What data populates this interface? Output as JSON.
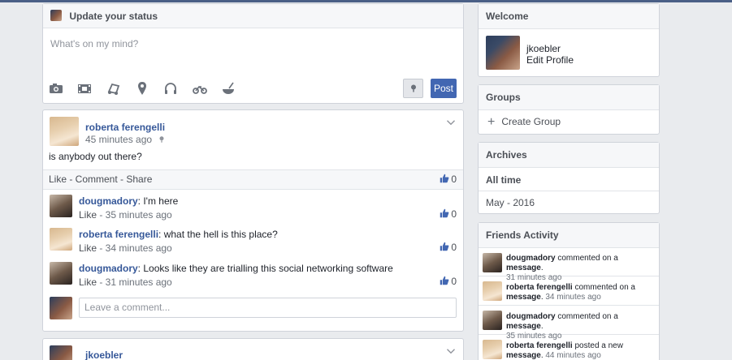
{
  "status_box": {
    "title": "Update your status",
    "placeholder": "What's on my mind?",
    "post_label": "Post",
    "tool_icons": [
      "camera-icon",
      "video-icon",
      "music-icon",
      "location-icon",
      "headphones-icon",
      "bike-icon",
      "food-icon"
    ]
  },
  "post": {
    "author": "roberta ferengelli",
    "time": "45 minutes ago",
    "text": "is anybody out there?",
    "actions": "Like - Comment - Share",
    "likes": "0",
    "comments": [
      {
        "author": "dougmadory",
        "text": ": I'm here",
        "meta_like": "Like",
        "meta_time": " - 35 minutes ago",
        "likes": "0"
      },
      {
        "author": "roberta ferengelli",
        "text": ": what the hell is this place?",
        "meta_like": "Like",
        "meta_time": " - 34 minutes ago",
        "likes": "0"
      },
      {
        "author": "dougmadory",
        "text": ": Looks like they are trialling this social networking software",
        "meta_like": "Like",
        "meta_time": " - 31 minutes ago",
        "likes": "0"
      }
    ],
    "comment_placeholder": "Leave a comment..."
  },
  "next_post": {
    "author": "jkoebler"
  },
  "welcome": {
    "title": "Welcome",
    "username": "jkoebler",
    "edit_profile": "Edit Profile"
  },
  "groups": {
    "title": "Groups",
    "create": "Create Group"
  },
  "archives": {
    "title": "Archives",
    "items": [
      "All time",
      "May - 2016"
    ]
  },
  "friends": {
    "title": "Friends Activity",
    "items": [
      {
        "name": "dougmadory",
        "action": " commented on a ",
        "object": "message",
        "time": "31 minutes ago"
      },
      {
        "name": "roberta ferengelli",
        "action": " commented on a ",
        "object": "message",
        "time": " 34 minutes ago"
      },
      {
        "name": "dougmadory",
        "action": " commented on a ",
        "object": "message",
        "time": "35 minutes ago"
      },
      {
        "name": "roberta ferengelli",
        "action": " posted a new ",
        "object": "message",
        "time": " 44 minutes ago"
      }
    ]
  },
  "colors": {
    "link": "#365899",
    "post_button": "#4267b2",
    "background": "#e9ebee"
  }
}
